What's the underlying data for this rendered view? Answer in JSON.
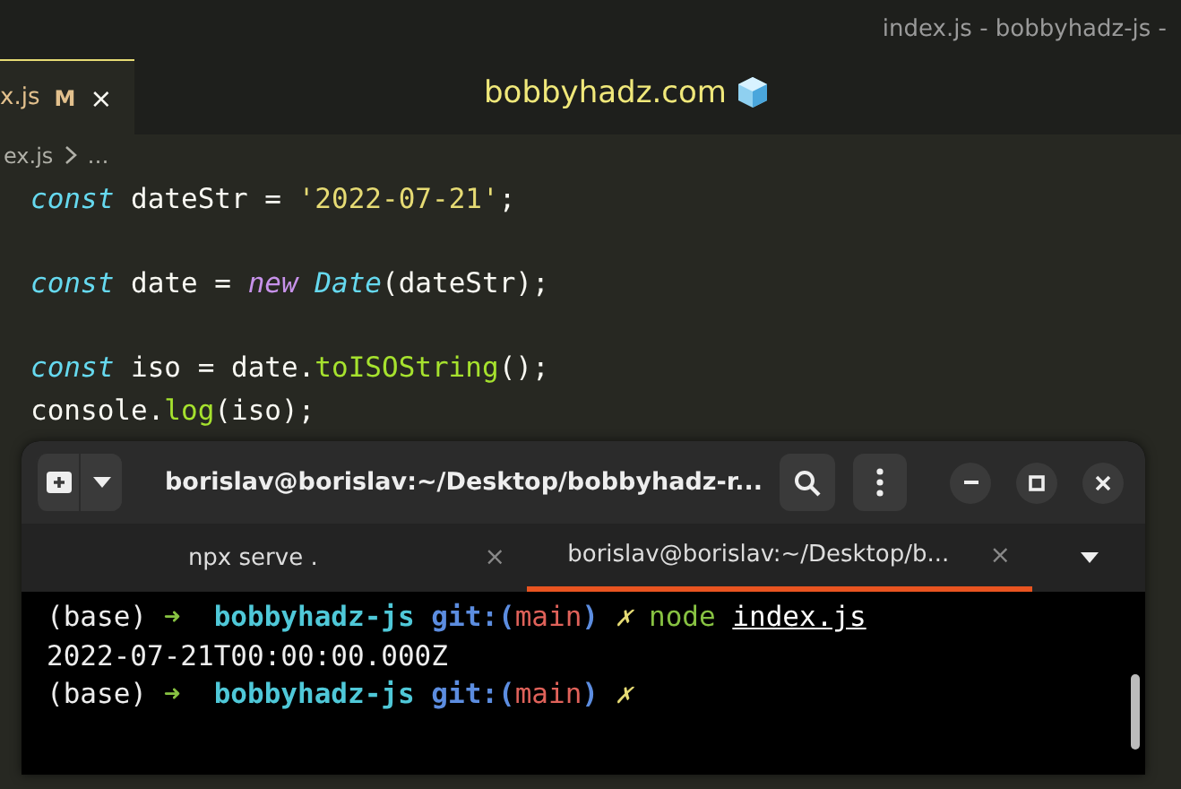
{
  "window": {
    "title": "index.js - bobbyhadz-js -"
  },
  "editor_tabs": [
    {
      "label": "x.js",
      "badge": "M",
      "close": "×",
      "selected": true
    }
  ],
  "watermark_title": "bobbyhadz.com",
  "breadcrumb": {
    "file": "ex.js",
    "more": "…"
  },
  "code_blocks": [
    [
      [
        {
          "kind": "keyword",
          "text": "const"
        },
        {
          "kind": "plain",
          "text": " dateStr = "
        },
        {
          "kind": "string",
          "text": "'2022-07-21'"
        },
        {
          "kind": "plain",
          "text": ";"
        }
      ]
    ],
    [
      [
        {
          "kind": "keyword",
          "text": "const"
        },
        {
          "kind": "plain",
          "text": " date = "
        },
        {
          "kind": "operator",
          "text": "new"
        },
        {
          "kind": "class",
          "text": " Date"
        },
        {
          "kind": "plain",
          "text": "(dateStr);"
        }
      ]
    ],
    [
      [
        {
          "kind": "keyword",
          "text": "const"
        },
        {
          "kind": "plain",
          "text": " iso = date."
        },
        {
          "kind": "function",
          "text": "toISOString"
        },
        {
          "kind": "plain",
          "text": "();"
        }
      ],
      [
        {
          "kind": "plain",
          "text": "console."
        },
        {
          "kind": "function",
          "text": "log"
        },
        {
          "kind": "plain",
          "text": "(iso);"
        }
      ]
    ]
  ],
  "terminal": {
    "title": "borislav@borislav:~/Desktop/bobbyhadz-r...",
    "tabs": [
      {
        "label": "npx serve .",
        "close": "×",
        "selected": false
      },
      {
        "label": "borislav@borislav:~/Desktop/b...",
        "close": "×",
        "selected": true
      }
    ],
    "lines": [
      [
        {
          "kind": "plain",
          "text": "(base) "
        },
        {
          "kind": "arrow",
          "text": "➜"
        },
        {
          "kind": "dir",
          "text": "  bobbyhadz-js"
        },
        {
          "kind": "git",
          "text": " git:("
        },
        {
          "kind": "branch",
          "text": "main"
        },
        {
          "kind": "git",
          "text": ")"
        },
        {
          "kind": "dirty",
          "text": " ✗"
        },
        {
          "kind": "command",
          "text": " node "
        },
        {
          "kind": "argument",
          "text": "index.js"
        }
      ],
      [
        {
          "kind": "plain",
          "text": "2022-07-21T00:00:00.000Z"
        }
      ],
      [
        {
          "kind": "plain",
          "text": "(base) "
        },
        {
          "kind": "arrow",
          "text": "➜"
        },
        {
          "kind": "dir",
          "text": "  bobbyhadz-js"
        },
        {
          "kind": "git",
          "text": " git:("
        },
        {
          "kind": "branch",
          "text": "main"
        },
        {
          "kind": "git",
          "text": ")"
        },
        {
          "kind": "dirty",
          "text": " ✗"
        }
      ]
    ]
  }
}
